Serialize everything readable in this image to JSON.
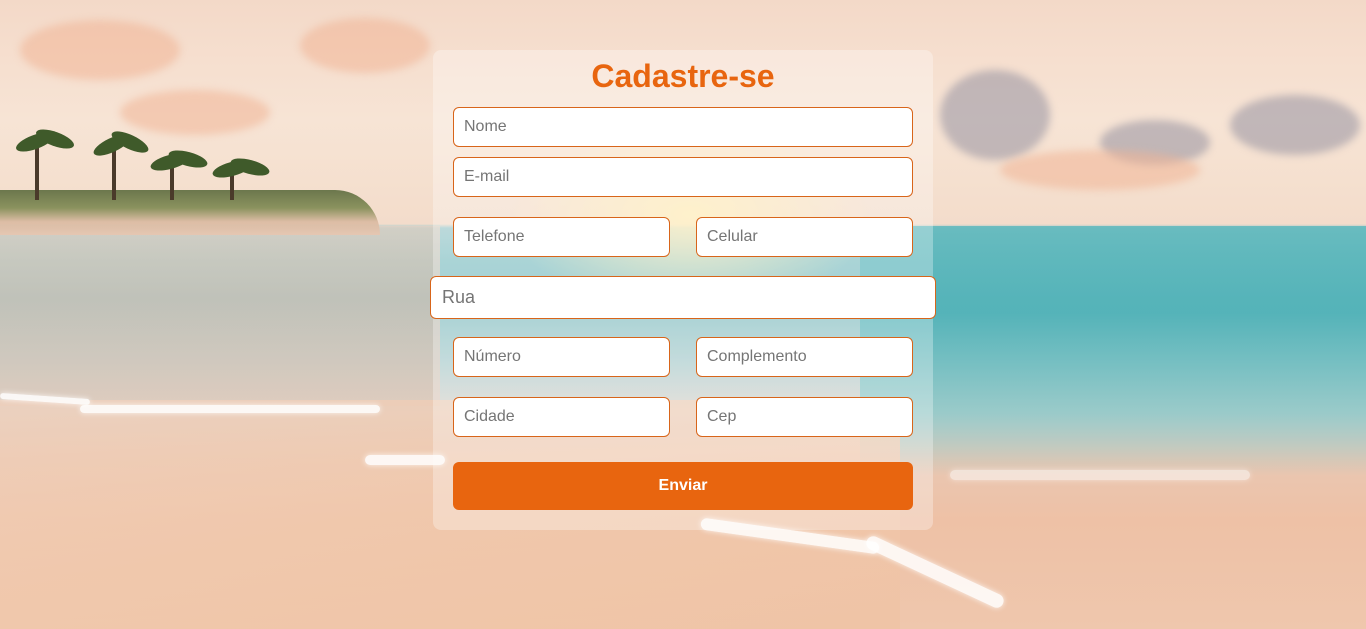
{
  "form": {
    "title": "Cadastre-se",
    "fields": {
      "nome": "Nome",
      "email": "E-mail",
      "telefone": "Telefone",
      "celular": "Celular",
      "rua": "Rua",
      "numero": "Número",
      "complemento": "Complemento",
      "cidade": "Cidade",
      "cep": "Cep"
    },
    "submit_label": "Enviar"
  },
  "colors": {
    "accent": "#e8650f",
    "input_border": "#d8651a"
  }
}
